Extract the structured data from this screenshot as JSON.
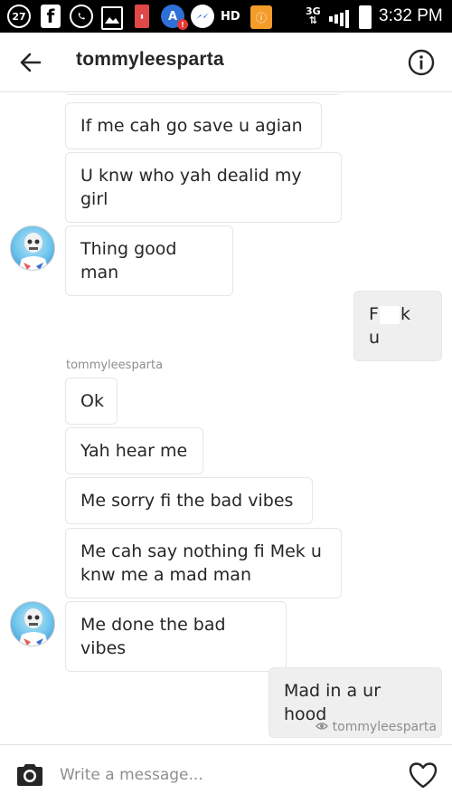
{
  "status_bar": {
    "notification_count": "27",
    "hd_label": "HD",
    "network_label": "3G",
    "time": "3:32 PM"
  },
  "header": {
    "title": "tommyleesparta"
  },
  "thread": {
    "messages_before": [
      {
        "text": "If me cah go save u agian"
      },
      {
        "text": "U knw who yah dealid my girl"
      },
      {
        "text": "Thing good man"
      }
    ],
    "outgoing_1": {
      "text_before": "F",
      "text_after": "k u"
    },
    "sender_label": "tommyleesparta",
    "messages_after": [
      {
        "text": "Ok"
      },
      {
        "text": "Yah hear me"
      },
      {
        "text": "Me sorry fi the bad vibes"
      },
      {
        "text": "Me cah say nothing fi Mek u knw me a mad man"
      },
      {
        "text": "Me done the bad vibes"
      }
    ],
    "outgoing_2": {
      "text": "Mad in a ur hood"
    },
    "seen_by": "tommyleesparta"
  },
  "composer": {
    "placeholder": "Write a message..."
  },
  "icons": {
    "back": "arrow-left-icon",
    "info": "info-circle-icon",
    "camera": "camera-icon",
    "heart": "heart-outline-icon",
    "seen": "eye-icon"
  }
}
